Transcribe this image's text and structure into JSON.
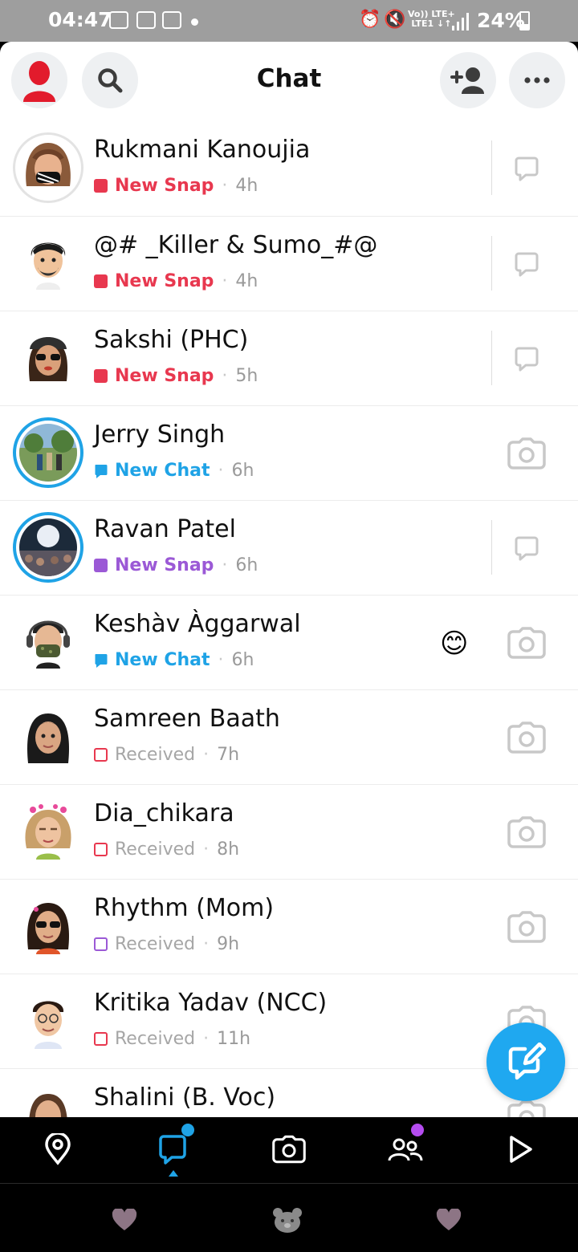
{
  "status_bar": {
    "time": "04:47",
    "lte_top": "Vo)) LTE+",
    "lte_bottom": "LTE1 ↓↑",
    "battery": "24%"
  },
  "header": {
    "title": "Chat",
    "icons": [
      "profile-avatar-icon",
      "search-icon",
      "add-friend-icon",
      "more-icon"
    ]
  },
  "chats": [
    {
      "name": "Rukmani Kanoujia",
      "status": "New Snap",
      "time": "4h",
      "status_color": "#e8384f",
      "kind": "snap"
    },
    {
      "name": "@# _Killer & Sumo_#@",
      "status": "New Snap",
      "time": "4h",
      "status_color": "#e8384f",
      "kind": "snap"
    },
    {
      "name": "Sakshi (PHC)",
      "status": "New Snap",
      "time": "5h",
      "status_color": "#e8384f",
      "kind": "snap"
    },
    {
      "name": "Jerry Singh",
      "status": "New Chat",
      "time": "6h",
      "status_color": "#1fa3e6",
      "kind": "chat"
    },
    {
      "name": "Ravan Patel",
      "status": "New Snap",
      "time": "6h",
      "status_color": "#9b59d6",
      "kind": "snap"
    },
    {
      "name": "Keshàv Àggarwal",
      "status": "New Chat",
      "time": "6h",
      "status_color": "#1fa3e6",
      "kind": "chat",
      "emoji": "😊"
    },
    {
      "name": "Samreen Baath",
      "status": "Received",
      "time": "7h",
      "status_color": "#e8384f",
      "kind": "received"
    },
    {
      "name": "Dia_chikara",
      "status": "Received",
      "time": "8h",
      "status_color": "#e8384f",
      "kind": "received"
    },
    {
      "name": "Rhythm (Mom)",
      "status": "Received",
      "time": "9h",
      "status_color": "#9b59d6",
      "kind": "received"
    },
    {
      "name": "Kritika Yadav (NCC)",
      "status": "Received",
      "time": "11h",
      "status_color": "#e8384f",
      "kind": "received"
    },
    {
      "name": "Shalini (B. Voc)",
      "status": "",
      "time": "",
      "status_color": "#e8384f",
      "kind": "received"
    }
  ],
  "bottom_nav": {
    "items": [
      "map-pin-icon",
      "chat-icon",
      "camera-icon",
      "friends-icon",
      "play-icon"
    ],
    "active": "chat-icon",
    "chat_badge_color": "#1fa3e6",
    "friends_badge_color": "#b54cf0"
  },
  "colors": {
    "snap_red": "#e8384f",
    "chat_blue": "#1fa3e6",
    "snap_purple": "#9b59d6",
    "fab_blue": "#1fa8f0"
  }
}
